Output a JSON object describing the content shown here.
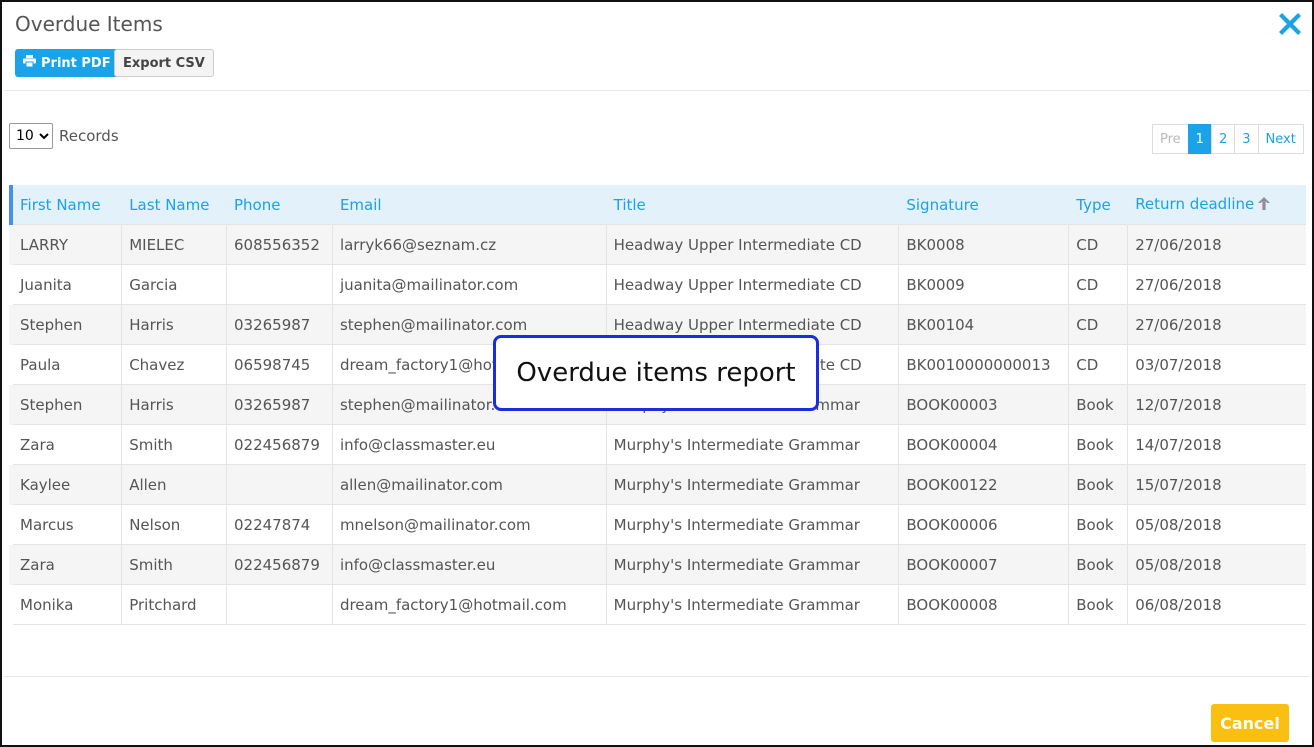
{
  "modal": {
    "title": "Overdue Items",
    "print_label": "Print PDF",
    "export_label": "Export CSV",
    "cancel_label": "Cancel"
  },
  "records": {
    "selected": "10",
    "label": "Records"
  },
  "pagination": {
    "prev": "Pre",
    "pages": [
      "1",
      "2",
      "3"
    ],
    "active_page": "1",
    "next": "Next"
  },
  "table": {
    "columns": [
      "First Name",
      "Last Name",
      "Phone",
      "Email",
      "Title",
      "Signature",
      "Type",
      "Return deadline"
    ],
    "sorted_column": "Return deadline",
    "rows": [
      [
        "LARRY",
        "MIELEC",
        "608556352",
        "larryk66@seznam.cz",
        "Headway Upper Intermediate CD",
        "BK0008",
        "CD",
        "27/06/2018"
      ],
      [
        "Juanita",
        "Garcia",
        "",
        "juanita@mailinator.com",
        "Headway Upper Intermediate CD",
        "BK0009",
        "CD",
        "27/06/2018"
      ],
      [
        "Stephen",
        "Harris",
        "03265987",
        "stephen@mailinator.com",
        "Headway Upper Intermediate CD",
        "BK00104",
        "CD",
        "27/06/2018"
      ],
      [
        "Paula",
        "Chavez",
        "06598745",
        "dream_factory1@hotmail.com",
        "Headway Upper Intermediate CD",
        "BK0010000000013",
        "CD",
        "03/07/2018"
      ],
      [
        "Stephen",
        "Harris",
        "03265987",
        "stephen@mailinator.com",
        "Murphy's Intermediate Grammar",
        "BOOK00003",
        "Book",
        "12/07/2018"
      ],
      [
        "Zara",
        "Smith",
        "022456879",
        "info@classmaster.eu",
        "Murphy's Intermediate Grammar",
        "BOOK00004",
        "Book",
        "14/07/2018"
      ],
      [
        "Kaylee",
        "Allen",
        "",
        "allen@mailinator.com",
        "Murphy's Intermediate Grammar",
        "BOOK00122",
        "Book",
        "15/07/2018"
      ],
      [
        "Marcus",
        "Nelson",
        "02247874",
        "mnelson@mailinator.com",
        "Murphy's Intermediate Grammar",
        "BOOK00006",
        "Book",
        "05/08/2018"
      ],
      [
        "Zara",
        "Smith",
        "022456879",
        "info@classmaster.eu",
        "Murphy's Intermediate Grammar",
        "BOOK00007",
        "Book",
        "05/08/2018"
      ],
      [
        "Monika",
        "Pritchard",
        "",
        "dream_factory1@hotmail.com",
        "Murphy's Intermediate Grammar",
        "BOOK00008",
        "Book",
        "06/08/2018"
      ]
    ]
  },
  "callout": {
    "text": "Overdue items report"
  },
  "icons": {
    "close": "close-icon",
    "print": "printer-icon",
    "sort": "arrow-up-icon"
  },
  "colors": {
    "accent": "#1aa3e8",
    "cancel": "#fbbf12",
    "callout_border": "#1a2ee0"
  }
}
